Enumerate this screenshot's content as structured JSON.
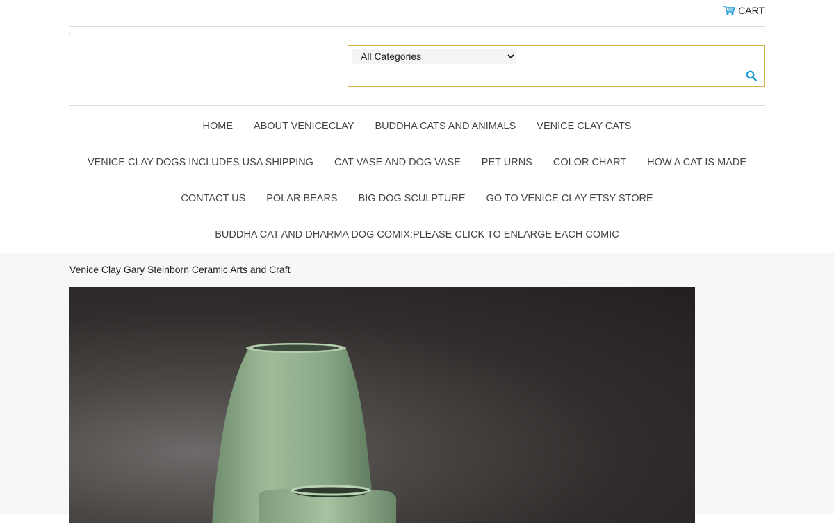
{
  "header": {
    "cart_label": "CART",
    "cart_icon": "cart-icon",
    "accent_color": "#1a9ad6",
    "search_border_color": "#d4b44a"
  },
  "search": {
    "category_selected": "All Categories",
    "search_icon": "search-icon"
  },
  "nav": {
    "items": [
      "HOME",
      "ABOUT VENICECLAY",
      "BUDDHA CATS AND ANIMALS",
      "VENICE CLAY CATS",
      "VENICE CLAY DOGS INCLUDES USA SHIPPING",
      "CAT VASE AND DOG VASE",
      "PET URNS",
      "COLOR CHART",
      "HOW A CAT IS MADE",
      "CONTACT US",
      "POLAR BEARS",
      "BIG DOG SCULPTURE",
      "GO TO VENICE CLAY ETSY STORE",
      "BUDDHA CAT AND DHARMA DOG COMIX:PLEASE CLICK TO ENLARGE EACH COMIC"
    ]
  },
  "main": {
    "heading": "Venice Clay Gary Steinborn Ceramic Arts and Craft",
    "photo_subject": "green-ceramic-vases-photo"
  }
}
